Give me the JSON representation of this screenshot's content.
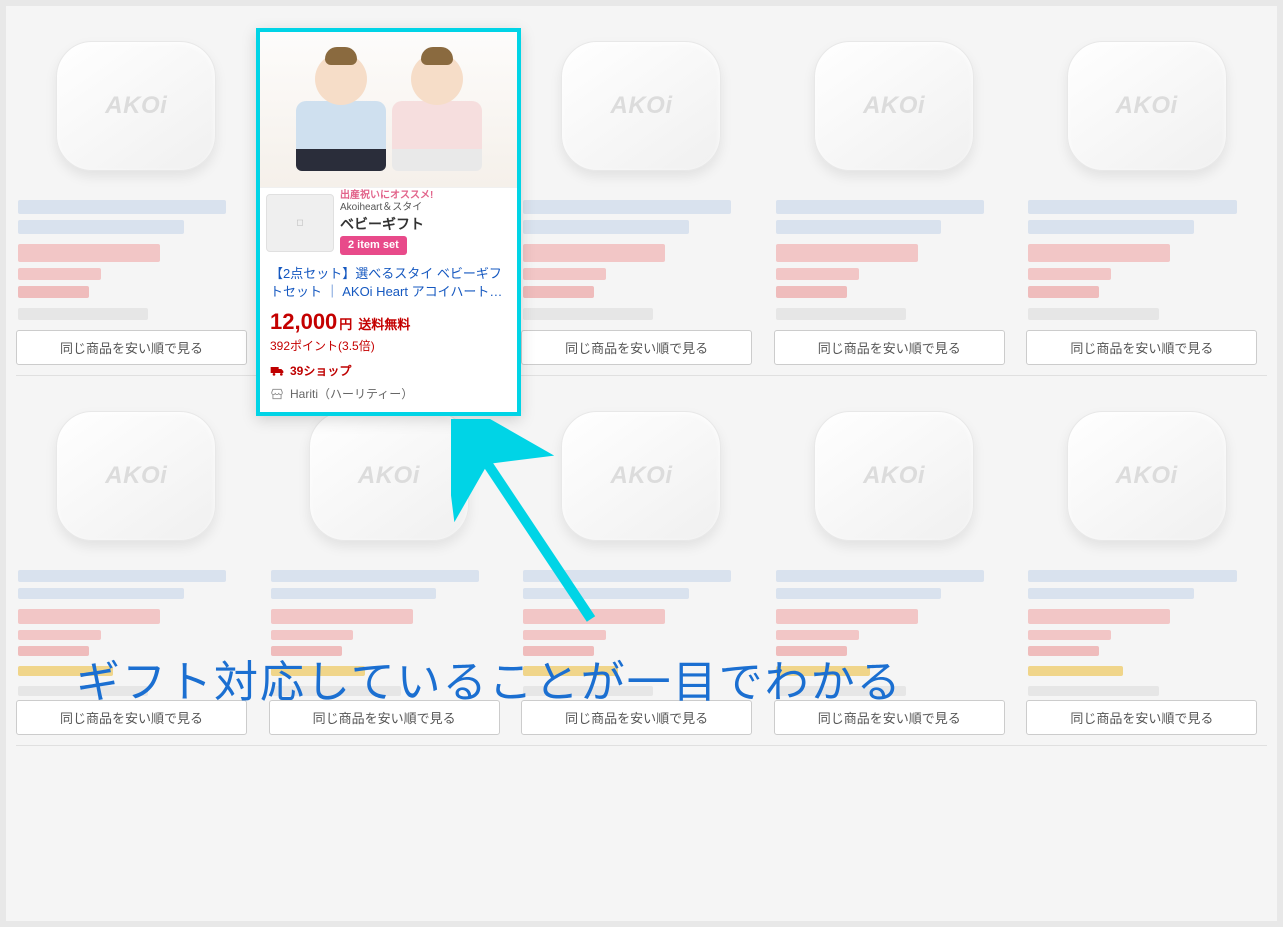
{
  "device_label": "AKOi",
  "same_button_label": "同じ商品を安い順で見る",
  "featured": {
    "banner": {
      "line1": "出産祝いにオススメ!",
      "line2": "Akoiheart＆スタイ",
      "line3": "ベビーギフト",
      "badge": "2 item set"
    },
    "title": "【2点セット】選べるスタイ ベビーギフトセット ｜ AKOi Heart アコイハート…",
    "price": "12,000",
    "yen_suffix": "円",
    "free_shipping": "送料無料",
    "points": "392ポイント(3.5倍)",
    "shop_badge": "39ショップ",
    "seller": "Hariti（ハーリティー）"
  },
  "annotation": "ギフト対応していることが一目でわかる"
}
